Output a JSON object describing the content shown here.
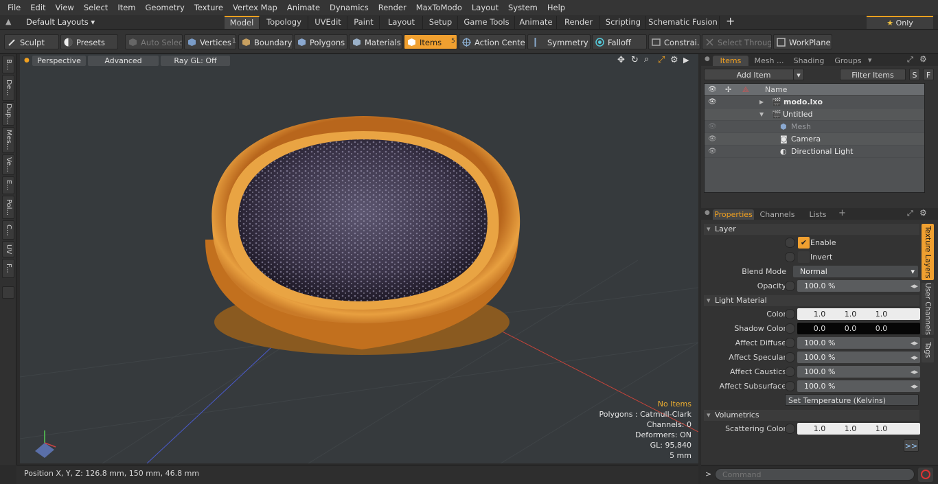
{
  "menu": [
    "File",
    "Edit",
    "View",
    "Select",
    "Item",
    "Geometry",
    "Texture",
    "Vertex Map",
    "Animate",
    "Dynamics",
    "Render",
    "MaxToModo",
    "Layout",
    "System",
    "Help"
  ],
  "layout_dropdown": "Default Layouts",
  "layout_tabs": [
    "Model",
    "Topology",
    "UVEdit",
    "Paint",
    "Layout",
    "Setup",
    "Game Tools",
    "Animate",
    "Render",
    "Scripting",
    "Schematic Fusion"
  ],
  "add_tab": "+",
  "only_label": "Only",
  "toolbar": {
    "sculpt": "Sculpt",
    "presets": "Presets",
    "auto_select": "Auto Select",
    "vertices": "Vertices",
    "vertices_count": "1",
    "boundary": "Boundary",
    "polygons": "Polygons",
    "materials": "Materials",
    "items": "Items",
    "items_count": "5",
    "action_center": "Action Center",
    "symmetry": "Symmetry",
    "falloff": "Falloff",
    "constraints": "Constrai...",
    "select_through": "Select Through",
    "workplane": "WorkPlane"
  },
  "left_tabs": [
    "B...",
    "De...",
    "Dup...",
    "Mes...",
    "Ve...",
    "E...",
    "Pol...",
    "C...",
    "UV",
    "F..."
  ],
  "viewport": {
    "perspective": "Perspective",
    "advanced": "Advanced",
    "raygl": "Ray GL: Off",
    "stats": [
      "No Items",
      "Polygons : Catmull-Clark",
      "Channels: 0",
      "Deformers: ON",
      "GL: 95,840",
      "5 mm"
    ]
  },
  "status": {
    "position": "Position X, Y, Z:   126.8 mm, 150 mm, 46.8 mm"
  },
  "items_panel": {
    "tabs": [
      "Items",
      "Mesh ...",
      "Shading",
      "Groups"
    ],
    "add_item": "Add Item",
    "filter": "Filter Items",
    "s": "S",
    "f": "F",
    "col_name": "Name",
    "rows": [
      {
        "name": "modo.lxo"
      },
      {
        "name": "Untitled"
      },
      {
        "name": "Mesh"
      },
      {
        "name": "Camera"
      },
      {
        "name": "Directional Light"
      }
    ]
  },
  "props_panel": {
    "tabs": [
      "Properties",
      "Channels",
      "Lists"
    ],
    "add": "+",
    "side_tabs": [
      "Texture Layers",
      "User Channels",
      "Tags"
    ],
    "layer_section": "Layer",
    "enable": "Enable",
    "invert": "Invert",
    "blend_label": "Blend Mode",
    "blend_value": "Normal",
    "opacity_label": "Opacity",
    "opacity_value": "100.0 %",
    "light_section": "Light Material",
    "color_label": "Color",
    "color": [
      "1.0",
      "1.0",
      "1.0"
    ],
    "shadow_label": "Shadow Color",
    "shadow": [
      "0.0",
      "0.0",
      "0.0"
    ],
    "affect": [
      {
        "label": "Affect Diffuse",
        "value": "100.0 %"
      },
      {
        "label": "Affect Specular",
        "value": "100.0 %"
      },
      {
        "label": "Affect Caustics",
        "value": "100.0 %"
      },
      {
        "label": "Affect Subsurface",
        "value": "100.0 %"
      }
    ],
    "set_temp": "Set Temperature (Kelvins)",
    "vol_section": "Volumetrics",
    "scatter_label": "Scattering Color",
    "scatter": [
      "1.0",
      "1.0",
      "1.0"
    ],
    "more": ">>"
  },
  "command": {
    "prompt": ">",
    "placeholder": "Command"
  },
  "colors": {
    "accent": "#f0a020",
    "bg": "#2b2b2b"
  }
}
